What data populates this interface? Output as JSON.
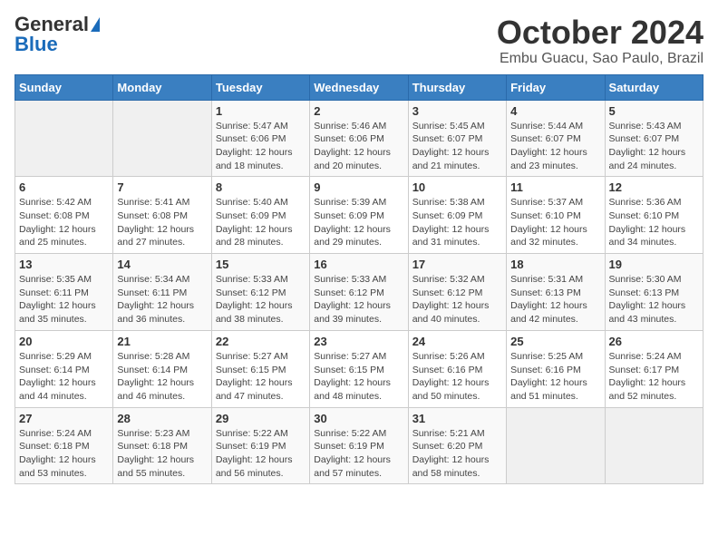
{
  "header": {
    "logo_line1": "General",
    "logo_line2": "Blue",
    "title": "October 2024",
    "subtitle": "Embu Guacu, Sao Paulo, Brazil"
  },
  "weekdays": [
    "Sunday",
    "Monday",
    "Tuesday",
    "Wednesday",
    "Thursday",
    "Friday",
    "Saturday"
  ],
  "weeks": [
    [
      {
        "day": "",
        "sunrise": "",
        "sunset": "",
        "daylight": ""
      },
      {
        "day": "",
        "sunrise": "",
        "sunset": "",
        "daylight": ""
      },
      {
        "day": "1",
        "sunrise": "Sunrise: 5:47 AM",
        "sunset": "Sunset: 6:06 PM",
        "daylight": "Daylight: 12 hours and 18 minutes."
      },
      {
        "day": "2",
        "sunrise": "Sunrise: 5:46 AM",
        "sunset": "Sunset: 6:06 PM",
        "daylight": "Daylight: 12 hours and 20 minutes."
      },
      {
        "day": "3",
        "sunrise": "Sunrise: 5:45 AM",
        "sunset": "Sunset: 6:07 PM",
        "daylight": "Daylight: 12 hours and 21 minutes."
      },
      {
        "day": "4",
        "sunrise": "Sunrise: 5:44 AM",
        "sunset": "Sunset: 6:07 PM",
        "daylight": "Daylight: 12 hours and 23 minutes."
      },
      {
        "day": "5",
        "sunrise": "Sunrise: 5:43 AM",
        "sunset": "Sunset: 6:07 PM",
        "daylight": "Daylight: 12 hours and 24 minutes."
      }
    ],
    [
      {
        "day": "6",
        "sunrise": "Sunrise: 5:42 AM",
        "sunset": "Sunset: 6:08 PM",
        "daylight": "Daylight: 12 hours and 25 minutes."
      },
      {
        "day": "7",
        "sunrise": "Sunrise: 5:41 AM",
        "sunset": "Sunset: 6:08 PM",
        "daylight": "Daylight: 12 hours and 27 minutes."
      },
      {
        "day": "8",
        "sunrise": "Sunrise: 5:40 AM",
        "sunset": "Sunset: 6:09 PM",
        "daylight": "Daylight: 12 hours and 28 minutes."
      },
      {
        "day": "9",
        "sunrise": "Sunrise: 5:39 AM",
        "sunset": "Sunset: 6:09 PM",
        "daylight": "Daylight: 12 hours and 29 minutes."
      },
      {
        "day": "10",
        "sunrise": "Sunrise: 5:38 AM",
        "sunset": "Sunset: 6:09 PM",
        "daylight": "Daylight: 12 hours and 31 minutes."
      },
      {
        "day": "11",
        "sunrise": "Sunrise: 5:37 AM",
        "sunset": "Sunset: 6:10 PM",
        "daylight": "Daylight: 12 hours and 32 minutes."
      },
      {
        "day": "12",
        "sunrise": "Sunrise: 5:36 AM",
        "sunset": "Sunset: 6:10 PM",
        "daylight": "Daylight: 12 hours and 34 minutes."
      }
    ],
    [
      {
        "day": "13",
        "sunrise": "Sunrise: 5:35 AM",
        "sunset": "Sunset: 6:11 PM",
        "daylight": "Daylight: 12 hours and 35 minutes."
      },
      {
        "day": "14",
        "sunrise": "Sunrise: 5:34 AM",
        "sunset": "Sunset: 6:11 PM",
        "daylight": "Daylight: 12 hours and 36 minutes."
      },
      {
        "day": "15",
        "sunrise": "Sunrise: 5:33 AM",
        "sunset": "Sunset: 6:12 PM",
        "daylight": "Daylight: 12 hours and 38 minutes."
      },
      {
        "day": "16",
        "sunrise": "Sunrise: 5:33 AM",
        "sunset": "Sunset: 6:12 PM",
        "daylight": "Daylight: 12 hours and 39 minutes."
      },
      {
        "day": "17",
        "sunrise": "Sunrise: 5:32 AM",
        "sunset": "Sunset: 6:12 PM",
        "daylight": "Daylight: 12 hours and 40 minutes."
      },
      {
        "day": "18",
        "sunrise": "Sunrise: 5:31 AM",
        "sunset": "Sunset: 6:13 PM",
        "daylight": "Daylight: 12 hours and 42 minutes."
      },
      {
        "day": "19",
        "sunrise": "Sunrise: 5:30 AM",
        "sunset": "Sunset: 6:13 PM",
        "daylight": "Daylight: 12 hours and 43 minutes."
      }
    ],
    [
      {
        "day": "20",
        "sunrise": "Sunrise: 5:29 AM",
        "sunset": "Sunset: 6:14 PM",
        "daylight": "Daylight: 12 hours and 44 minutes."
      },
      {
        "day": "21",
        "sunrise": "Sunrise: 5:28 AM",
        "sunset": "Sunset: 6:14 PM",
        "daylight": "Daylight: 12 hours and 46 minutes."
      },
      {
        "day": "22",
        "sunrise": "Sunrise: 5:27 AM",
        "sunset": "Sunset: 6:15 PM",
        "daylight": "Daylight: 12 hours and 47 minutes."
      },
      {
        "day": "23",
        "sunrise": "Sunrise: 5:27 AM",
        "sunset": "Sunset: 6:15 PM",
        "daylight": "Daylight: 12 hours and 48 minutes."
      },
      {
        "day": "24",
        "sunrise": "Sunrise: 5:26 AM",
        "sunset": "Sunset: 6:16 PM",
        "daylight": "Daylight: 12 hours and 50 minutes."
      },
      {
        "day": "25",
        "sunrise": "Sunrise: 5:25 AM",
        "sunset": "Sunset: 6:16 PM",
        "daylight": "Daylight: 12 hours and 51 minutes."
      },
      {
        "day": "26",
        "sunrise": "Sunrise: 5:24 AM",
        "sunset": "Sunset: 6:17 PM",
        "daylight": "Daylight: 12 hours and 52 minutes."
      }
    ],
    [
      {
        "day": "27",
        "sunrise": "Sunrise: 5:24 AM",
        "sunset": "Sunset: 6:18 PM",
        "daylight": "Daylight: 12 hours and 53 minutes."
      },
      {
        "day": "28",
        "sunrise": "Sunrise: 5:23 AM",
        "sunset": "Sunset: 6:18 PM",
        "daylight": "Daylight: 12 hours and 55 minutes."
      },
      {
        "day": "29",
        "sunrise": "Sunrise: 5:22 AM",
        "sunset": "Sunset: 6:19 PM",
        "daylight": "Daylight: 12 hours and 56 minutes."
      },
      {
        "day": "30",
        "sunrise": "Sunrise: 5:22 AM",
        "sunset": "Sunset: 6:19 PM",
        "daylight": "Daylight: 12 hours and 57 minutes."
      },
      {
        "day": "31",
        "sunrise": "Sunrise: 5:21 AM",
        "sunset": "Sunset: 6:20 PM",
        "daylight": "Daylight: 12 hours and 58 minutes."
      },
      {
        "day": "",
        "sunrise": "",
        "sunset": "",
        "daylight": ""
      },
      {
        "day": "",
        "sunrise": "",
        "sunset": "",
        "daylight": ""
      }
    ]
  ]
}
